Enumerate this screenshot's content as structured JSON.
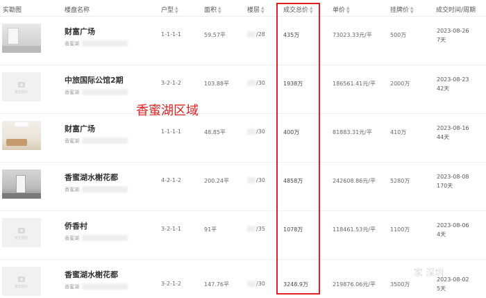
{
  "columns": {
    "photo": "实勘图",
    "name": "楼盘名称",
    "layout": "户型",
    "area": "面积",
    "floor": "楼层",
    "total_price": "成交总价",
    "unit_price": "单价",
    "list_price": "挂牌价",
    "deal_time": "成交时间/周期"
  },
  "placeholder_text": "暂无图片",
  "overlay_label": "香蜜湖区域",
  "watermark": "家 深圳",
  "rows": [
    {
      "name": "财富广场",
      "district": "香蜜湖",
      "layout": "1-1-1-1",
      "area": "59.57平",
      "floor": "/28",
      "total": "435万",
      "unit": "73023.33元/平",
      "listing": "500万",
      "date": "2023-08-26",
      "cycle": "7天"
    },
    {
      "name": "中旅国际公馆2期",
      "district": "香蜜湖",
      "layout": "3-2-1-2",
      "area": "103.88平",
      "floor": "/30",
      "total": "1938万",
      "unit": "186561.41元/平",
      "listing": "2000万",
      "date": "2023-08-23",
      "cycle": "42天"
    },
    {
      "name": "财富广场",
      "district": "香蜜湖",
      "layout": "1-1-1-1",
      "area": "48.85平",
      "floor": "/30",
      "total": "400万",
      "unit": "81883.31元/平",
      "listing": "410万",
      "date": "2023-08-16",
      "cycle": "44天"
    },
    {
      "name": "香蜜湖水榭花都",
      "district": "香蜜湖",
      "layout": "4-2-1-2",
      "area": "200.24平",
      "floor": "/30",
      "total": "4858万",
      "unit": "242608.86元/平",
      "listing": "5280万",
      "date": "2023-08-08",
      "cycle": "170天"
    },
    {
      "name": "侨香村",
      "district": "香蜜湖",
      "layout": "3-2-1-1",
      "area": "91平",
      "floor": "/35",
      "total": "1078万",
      "unit": "118461.53元/平",
      "listing": "1100万",
      "date": "2023-08-06",
      "cycle": "4天"
    },
    {
      "name": "香蜜湖水榭花都",
      "district": "香蜜湖",
      "layout": "3-2-1-2",
      "area": "147.76平",
      "floor": "/30",
      "total": "3248.9万",
      "unit": "219876.06元/平",
      "listing": "3500万",
      "date": "2023-08-02",
      "cycle": "5天"
    }
  ]
}
